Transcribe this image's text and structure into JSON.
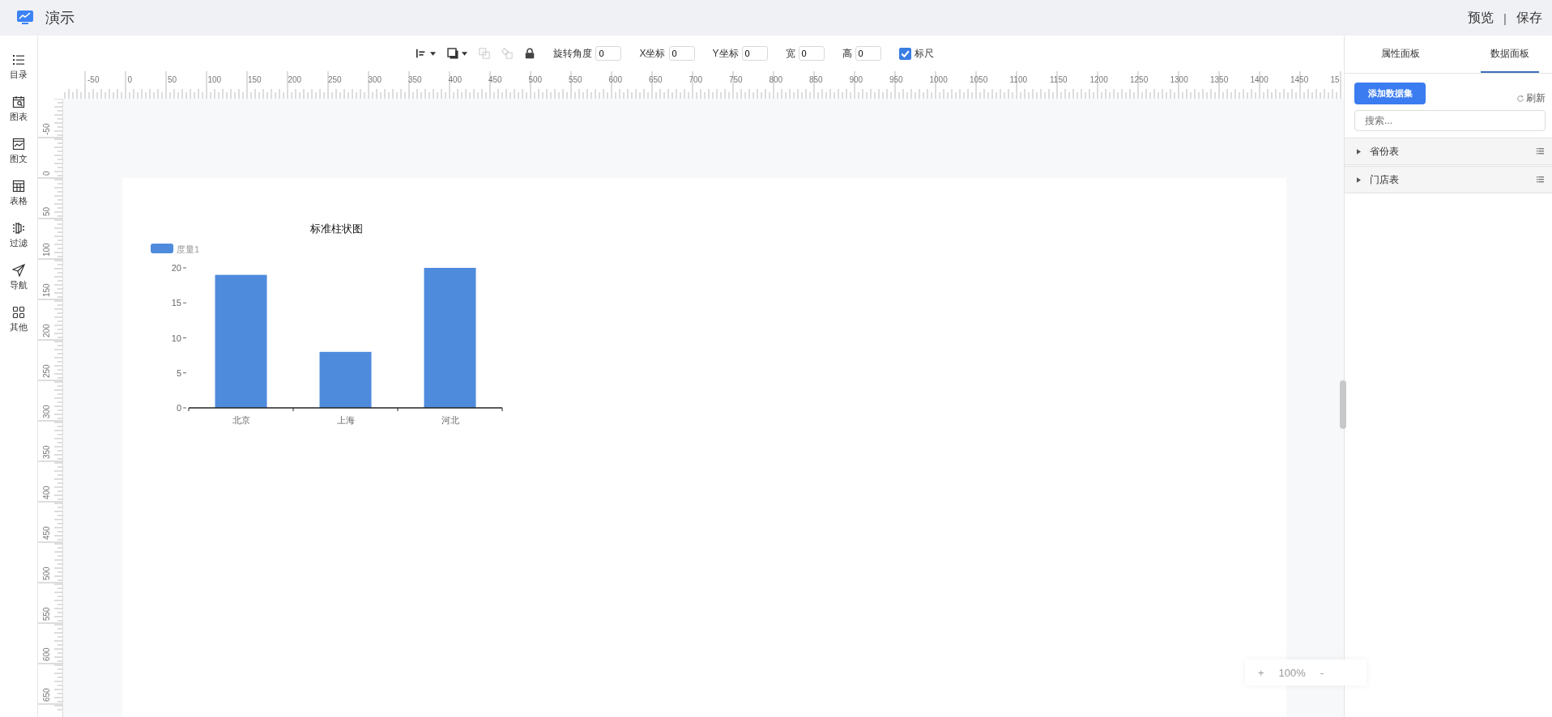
{
  "header": {
    "title": "演示",
    "actions": [
      {
        "label": "预览"
      },
      {
        "label": "保存"
      }
    ],
    "separator": "|"
  },
  "sidebar": {
    "items": [
      {
        "label": "目录"
      },
      {
        "label": "图表"
      },
      {
        "label": "图文"
      },
      {
        "label": "表格"
      },
      {
        "label": "过滤"
      },
      {
        "label": "导航"
      },
      {
        "label": "其他"
      }
    ]
  },
  "toolbar": {
    "fields": [
      {
        "label": "旋转角度",
        "value": "0"
      },
      {
        "label": "X坐标",
        "value": "0"
      },
      {
        "label": "Y坐标",
        "value": "0"
      },
      {
        "label": "宽",
        "value": "0"
      },
      {
        "label": "高",
        "value": "0"
      }
    ],
    "ruler_toggle": {
      "label": "标尺",
      "checked": true
    }
  },
  "rulers": {
    "horizontal": [
      "-50",
      "0",
      "50",
      "100",
      "150",
      "200",
      "250",
      "300",
      "350",
      "400",
      "450",
      "500",
      "550",
      "600",
      "650",
      "700",
      "750",
      "800",
      "850",
      "900",
      "950",
      "1000",
      "1050",
      "1100",
      "1150",
      "1200",
      "1250",
      "1300",
      "1350",
      "1400",
      "1450",
      "15"
    ],
    "vertical": [
      "-50",
      "0",
      "50",
      "100",
      "150",
      "200",
      "250",
      "300",
      "350",
      "400",
      "450",
      "500",
      "550",
      "600",
      "650"
    ]
  },
  "chart": {
    "chart_data": {
      "type": "bar",
      "title": "标准柱状图",
      "categories": [
        "北京",
        "上海",
        "河北"
      ],
      "series": [
        {
          "name": "度量1",
          "color": "#4f8bdc",
          "values": [
            19,
            8,
            20
          ]
        }
      ],
      "ylim": [
        0,
        20
      ],
      "yticks": [
        0,
        5,
        10,
        15,
        20
      ]
    }
  },
  "zoom": {
    "plus": "+",
    "value": "100%",
    "minus": "-"
  },
  "panel": {
    "tabs": [
      {
        "label": "属性面板",
        "selected": false
      },
      {
        "label": "数据面板",
        "selected": true
      }
    ],
    "add_button": "添加数据集",
    "refresh": "刷新",
    "search": {
      "placeholder": "搜索..."
    },
    "datasets": [
      {
        "name": "省份表",
        "expanded": false
      },
      {
        "name": "门店表",
        "expanded": false
      }
    ]
  }
}
